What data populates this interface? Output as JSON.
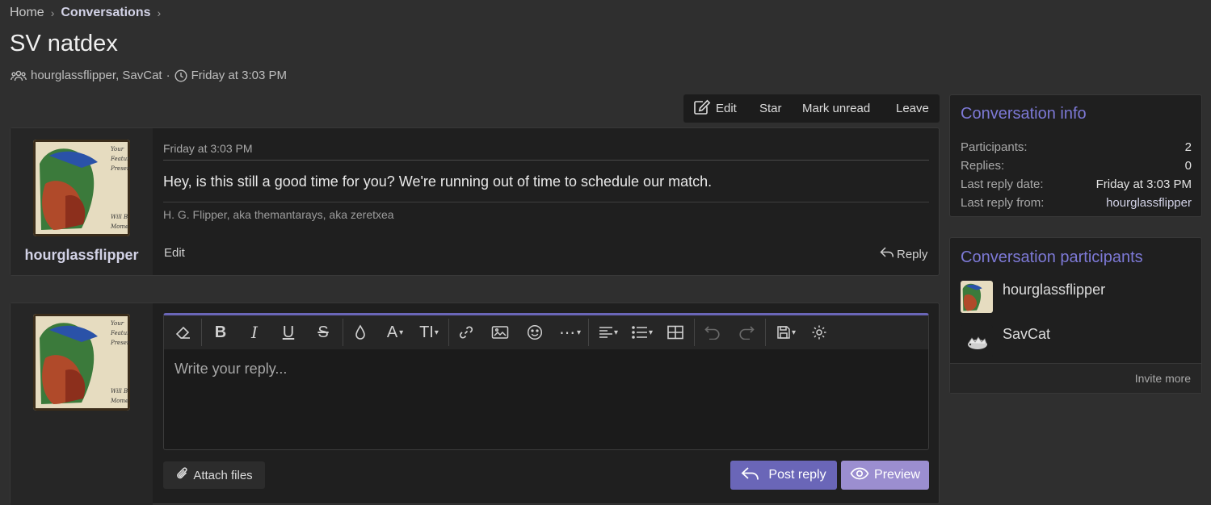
{
  "breadcrumb": {
    "home": "Home",
    "conversations": "Conversations"
  },
  "page": {
    "title": "SV natdex",
    "participants_text": "hourglassflipper, SavCat",
    "separator": "·",
    "date": "Friday at 3:03 PM"
  },
  "actions": {
    "edit": "Edit",
    "star": "Star",
    "mark_unread": "Mark unread",
    "leave": "Leave"
  },
  "message": {
    "author": "hourglassflipper",
    "date": "Friday at 3:03 PM",
    "body": "Hey, is this still a good time for you? We're running out of time to schedule our match.",
    "signature": "H. G. Flipper, aka themantarays, aka zeretxea",
    "edit_label": "Edit",
    "reply_label": "Reply"
  },
  "composer": {
    "placeholder": "Write your reply...",
    "attach_label": "Attach files",
    "post_label": "Post reply",
    "preview_label": "Preview",
    "toolbar_icons": [
      "eraser-icon",
      "bold-icon",
      "italic-icon",
      "underline-icon",
      "strike-icon",
      "color-icon",
      "font-family-icon",
      "font-size-icon",
      "link-icon",
      "image-icon",
      "smilie-icon",
      "more-icon",
      "align-icon",
      "list-icon",
      "table-icon",
      "undo-icon",
      "redo-icon",
      "drafts-icon",
      "settings-icon"
    ]
  },
  "info": {
    "title": "Conversation info",
    "rows": [
      {
        "label": "Participants:",
        "value": "2"
      },
      {
        "label": "Replies:",
        "value": "0"
      },
      {
        "label": "Last reply date:",
        "value": "Friday at 3:03 PM"
      },
      {
        "label": "Last reply from:",
        "value": "hourglassflipper"
      }
    ]
  },
  "participants": {
    "title": "Conversation participants",
    "list": [
      "hourglassflipper",
      "SavCat"
    ],
    "invite_label": "Invite more"
  },
  "colors": {
    "accent": "#6a66b8",
    "heading": "#7d79d6",
    "preview": "#9b8ed0",
    "background": "#2f2f2f"
  }
}
